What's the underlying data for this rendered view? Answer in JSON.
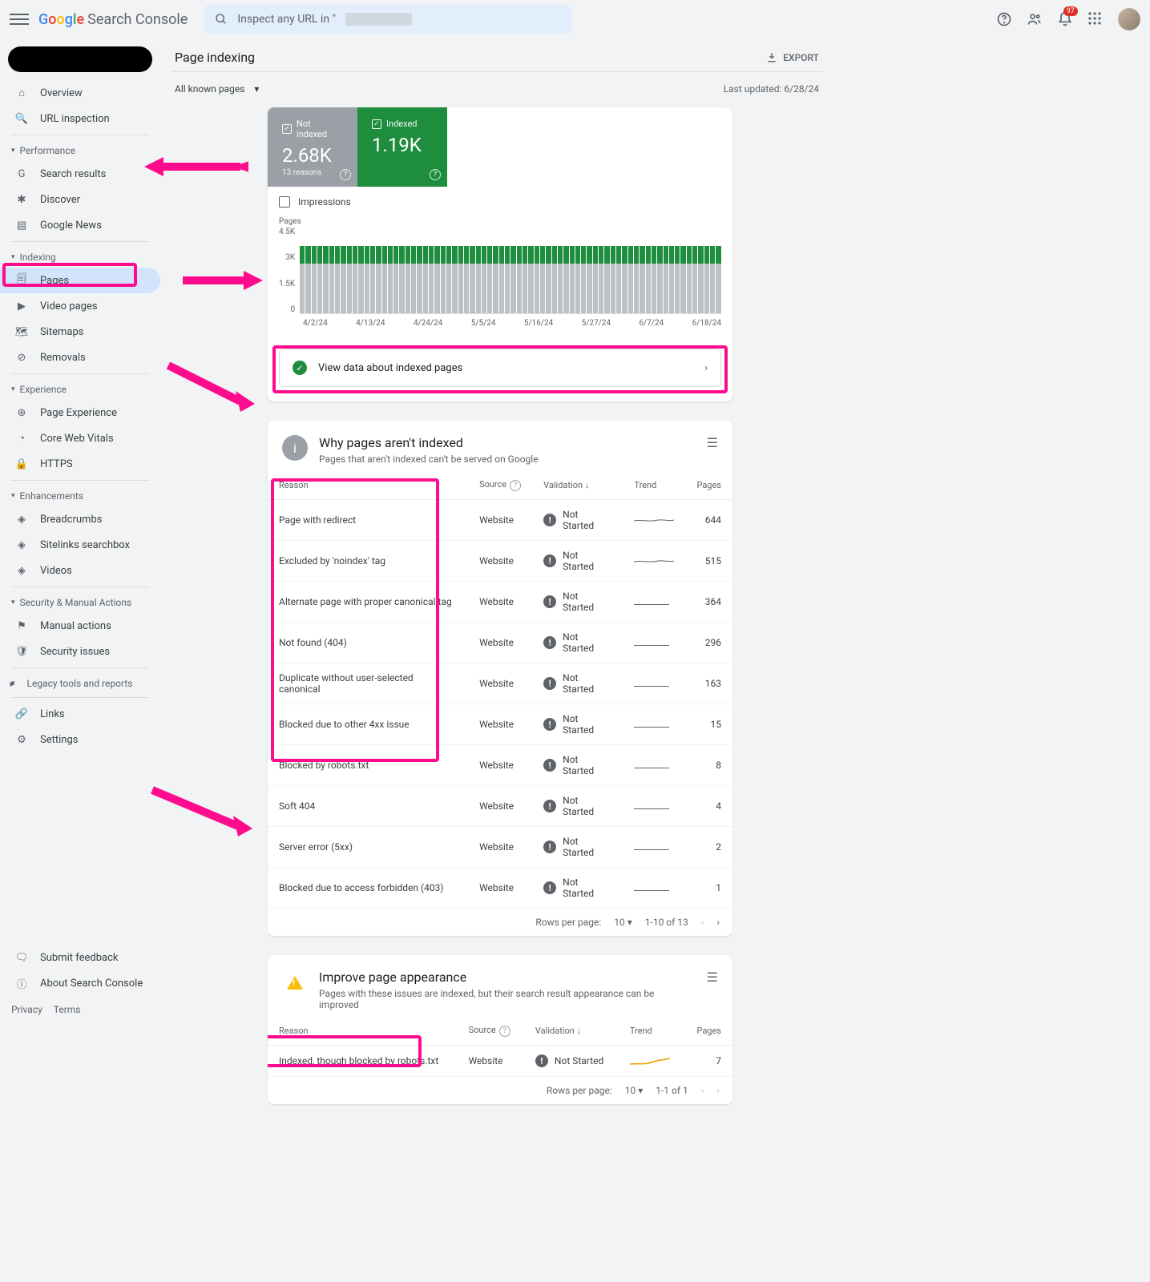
{
  "app_name": "Search Console",
  "search_placeholder": "Inspect any URL in \"",
  "notification_count": "97",
  "page_title": "Page indexing",
  "export_label": "EXPORT",
  "filter_label": "All known pages",
  "last_updated_prefix": "Last updated: ",
  "last_updated_value": "6/28/24",
  "stats": {
    "not_indexed": {
      "label": "Not indexed",
      "value": "2.68K",
      "sub": "13 reasons"
    },
    "indexed": {
      "label": "Indexed",
      "value": "1.19K"
    }
  },
  "impressions_label": "Impressions",
  "chart": {
    "y_label": "Pages",
    "y_ticks": [
      "4.5K",
      "3K",
      "1.5K",
      "0"
    ],
    "x_ticks": [
      "4/2/24",
      "4/13/24",
      "4/24/24",
      "5/5/24",
      "5/16/24",
      "5/27/24",
      "6/7/24",
      "6/18/24"
    ]
  },
  "view_data_label": "View data about indexed pages",
  "why_not_indexed": {
    "title": "Why pages aren't indexed",
    "subtitle": "Pages that aren't indexed can't be served on Google",
    "columns": {
      "reason": "Reason",
      "source": "Source",
      "validation": "Validation",
      "trend": "Trend",
      "pages": "Pages"
    },
    "rows": [
      {
        "reason": "Page with redirect",
        "source": "Website",
        "validation": "Not Started",
        "pages": "644"
      },
      {
        "reason": "Excluded by 'noindex' tag",
        "source": "Website",
        "validation": "Not Started",
        "pages": "515"
      },
      {
        "reason": "Alternate page with proper canonical tag",
        "source": "Website",
        "validation": "Not Started",
        "pages": "364"
      },
      {
        "reason": "Not found (404)",
        "source": "Website",
        "validation": "Not Started",
        "pages": "296"
      },
      {
        "reason": "Duplicate without user-selected canonical",
        "source": "Website",
        "validation": "Not Started",
        "pages": "163"
      },
      {
        "reason": "Blocked due to other 4xx issue",
        "source": "Website",
        "validation": "Not Started",
        "pages": "15"
      },
      {
        "reason": "Blocked by robots.txt",
        "source": "Website",
        "validation": "Not Started",
        "pages": "8"
      },
      {
        "reason": "Soft 404",
        "source": "Website",
        "validation": "Not Started",
        "pages": "4"
      },
      {
        "reason": "Server error (5xx)",
        "source": "Website",
        "validation": "Not Started",
        "pages": "2"
      },
      {
        "reason": "Blocked due to access forbidden (403)",
        "source": "Website",
        "validation": "Not Started",
        "pages": "1"
      }
    ],
    "pager": {
      "rows_per_page_label": "Rows per page:",
      "rows_per_page_value": "10",
      "range": "1-10 of 13"
    }
  },
  "improve_appearance": {
    "title": "Improve page appearance",
    "subtitle": "Pages with these issues are indexed, but their search result appearance can be improved",
    "columns": {
      "reason": "Reason",
      "source": "Source",
      "validation": "Validation",
      "trend": "Trend",
      "pages": "Pages"
    },
    "rows": [
      {
        "reason": "Indexed, though blocked by robots.txt",
        "source": "Website",
        "validation": "Not Started",
        "pages": "7"
      }
    ],
    "pager": {
      "rows_per_page_label": "Rows per page:",
      "rows_per_page_value": "10",
      "range": "1-1 of 1"
    }
  },
  "sidebar": {
    "overview": "Overview",
    "url_inspection": "URL inspection",
    "performance": "Performance",
    "search_results": "Search results",
    "discover": "Discover",
    "google_news": "Google News",
    "indexing": "Indexing",
    "pages": "Pages",
    "video_pages": "Video pages",
    "sitemaps": "Sitemaps",
    "removals": "Removals",
    "experience": "Experience",
    "page_experience": "Page Experience",
    "core_web_vitals": "Core Web Vitals",
    "https": "HTTPS",
    "enhancements": "Enhancements",
    "breadcrumbs": "Breadcrumbs",
    "sitelinks": "Sitelinks searchbox",
    "videos": "Videos",
    "security": "Security & Manual Actions",
    "manual_actions": "Manual actions",
    "security_issues": "Security issues",
    "legacy": "Legacy tools and reports",
    "links": "Links",
    "settings": "Settings",
    "submit_feedback": "Submit feedback",
    "about": "About Search Console",
    "privacy": "Privacy",
    "terms": "Terms"
  },
  "chart_data": {
    "type": "bar",
    "title": "Page indexing",
    "ylabel": "Pages",
    "ylim": [
      0,
      4500
    ],
    "x": [
      "4/2/24",
      "4/13/24",
      "4/24/24",
      "5/5/24",
      "5/16/24",
      "5/27/24",
      "6/7/24",
      "6/18/24"
    ],
    "series": [
      {
        "name": "Indexed",
        "color": "#1e8e3e",
        "approx_value": 1190
      },
      {
        "name": "Not indexed",
        "color": "#bdc1c6",
        "approx_value": 2680
      }
    ],
    "note": "Stacked daily bars roughly constant over range; totals ~3.87K"
  }
}
